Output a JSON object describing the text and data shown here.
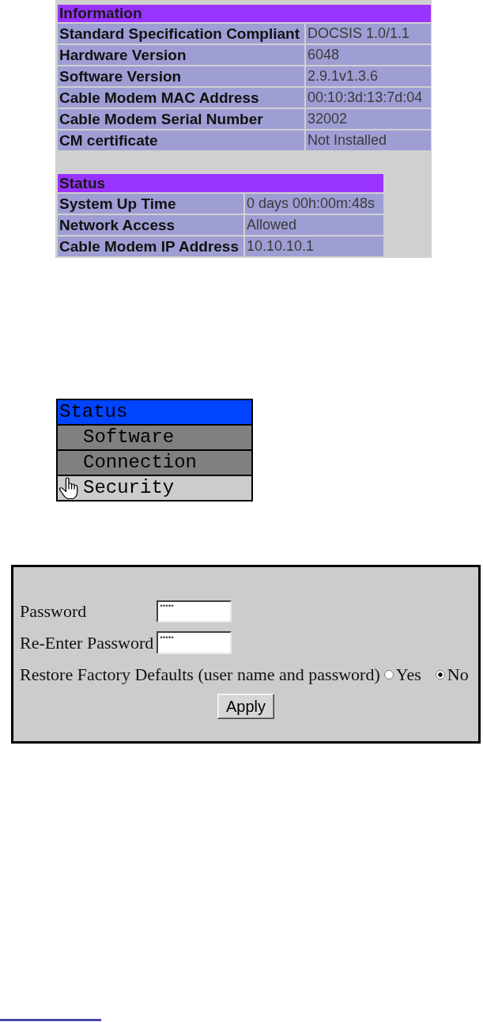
{
  "information": {
    "title": "Information",
    "rows": [
      {
        "label": "Standard Specification Compliant",
        "value": "DOCSIS 1.0/1.1"
      },
      {
        "label": "Hardware Version",
        "value": "6048"
      },
      {
        "label": "Software Version",
        "value": "2.9.1v1.3.6"
      },
      {
        "label": "Cable Modem MAC Address",
        "value": "00:10:3d:13:7d:04"
      },
      {
        "label": "Cable Modem Serial Number",
        "value": "32002"
      },
      {
        "label": "CM certificate",
        "value": "Not Installed"
      }
    ]
  },
  "status": {
    "title": "Status",
    "rows": [
      {
        "label": "System Up Time",
        "value": "0 days 00h:00m:48s"
      },
      {
        "label": "Network Access",
        "value": "Allowed"
      },
      {
        "label": "Cable Modem IP Address",
        "value": "10.10.10.1"
      }
    ]
  },
  "menu": {
    "items": [
      {
        "label": "Status",
        "selected": true,
        "children": [
          {
            "label": "Software",
            "selected": false,
            "hovered": false
          },
          {
            "label": "Connection",
            "selected": false,
            "hovered": false
          },
          {
            "label": "Security",
            "selected": false,
            "hovered": true
          }
        ]
      }
    ]
  },
  "password_form": {
    "fields": [
      {
        "label": "Password",
        "value": "*****"
      },
      {
        "label": "Re-Enter Password",
        "value": "*****"
      }
    ],
    "restore_defaults": {
      "label": "Restore Factory Defaults (user name and password)",
      "options": [
        {
          "label": "Yes",
          "selected": false
        },
        {
          "label": "No",
          "selected": true
        }
      ]
    },
    "apply_button": "Apply"
  }
}
